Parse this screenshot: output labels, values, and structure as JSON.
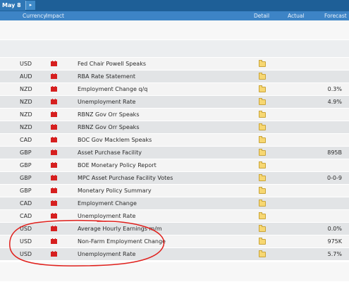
{
  "date_tab": "May 8",
  "nav_arrow": "▸",
  "columns": {
    "currency": "Currency",
    "impact": "Impact",
    "detail": "Detail",
    "actual": "Actual",
    "forecast": "Forecast"
  },
  "events": [
    {
      "currency": "USD",
      "event": "Fed Chair Powell Speaks",
      "forecast": ""
    },
    {
      "currency": "AUD",
      "event": "RBA Rate Statement",
      "forecast": ""
    },
    {
      "currency": "NZD",
      "event": "Employment Change q/q",
      "forecast": "0.3%"
    },
    {
      "currency": "NZD",
      "event": "Unemployment Rate",
      "forecast": "4.9%"
    },
    {
      "currency": "NZD",
      "event": "RBNZ Gov Orr Speaks",
      "forecast": ""
    },
    {
      "currency": "NZD",
      "event": "RBNZ Gov Orr Speaks",
      "forecast": ""
    },
    {
      "currency": "CAD",
      "event": "BOC Gov Macklem Speaks",
      "forecast": ""
    },
    {
      "currency": "GBP",
      "event": "Asset Purchase Facility",
      "forecast": "895B"
    },
    {
      "currency": "GBP",
      "event": "BOE Monetary Policy Report",
      "forecast": ""
    },
    {
      "currency": "GBP",
      "event": "MPC Asset Purchase Facility Votes",
      "forecast": "0-0-9"
    },
    {
      "currency": "GBP",
      "event": "Monetary Policy Summary",
      "forecast": ""
    },
    {
      "currency": "CAD",
      "event": "Employment Change",
      "forecast": ""
    },
    {
      "currency": "CAD",
      "event": "Unemployment Rate",
      "forecast": ""
    },
    {
      "currency": "USD",
      "event": "Average Hourly Earnings m/m",
      "forecast": "0.0%"
    },
    {
      "currency": "USD",
      "event": "Non-Farm Employment Change",
      "forecast": "975K"
    },
    {
      "currency": "USD",
      "event": "Unemployment Rate",
      "forecast": "5.7%"
    }
  ],
  "icons": {
    "impact": "high-impact-folder-icon",
    "detail": "detail-folder-icon"
  },
  "colors": {
    "header_bar": "#1e5f97",
    "column_header": "#3d84c6",
    "impact_red": "#d61f1f",
    "annotation_red": "#e0201c"
  }
}
